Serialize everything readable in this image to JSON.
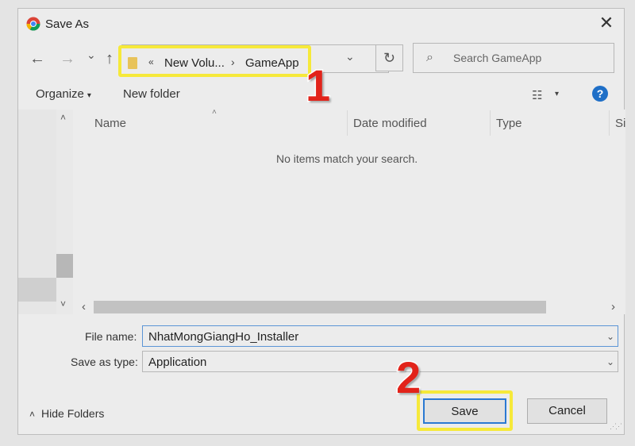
{
  "window": {
    "title": "Save As",
    "close_glyph": "✕"
  },
  "nav": {
    "back": "←",
    "forward": "→",
    "recent": "⌄",
    "up": "↑",
    "breadcrumb": {
      "overflow": "«",
      "part1": "New Volu...",
      "separator": "›",
      "part2": "GameApp"
    },
    "address_dropdown": "⌄",
    "refresh": "↻",
    "search_placeholder": "Search GameApp"
  },
  "toolbar": {
    "organize": "Organize",
    "organize_caret": "▾",
    "new_folder": "New folder",
    "view_icon": "☷",
    "view_caret": "▾",
    "help": "?"
  },
  "list": {
    "columns": {
      "name": "Name",
      "date_modified": "Date modified",
      "type": "Type",
      "size": "Si"
    },
    "sort_indicator": "˄",
    "empty_message": "No items match your search."
  },
  "scroll": {
    "up": "˄",
    "down": "˅",
    "left": "‹",
    "right": "›"
  },
  "form": {
    "file_name_label": "File name:",
    "file_name_value": "NhatMongGiangHo_Installer",
    "save_type_label": "Save as type:",
    "save_type_value": "Application",
    "dropdown_glyph": "⌄"
  },
  "footer": {
    "hide_folders_caret": "˄",
    "hide_folders": "Hide Folders",
    "save": "Save",
    "cancel": "Cancel",
    "grip": "⋰⋰"
  },
  "annotations": {
    "step1": "1",
    "step2": "2",
    "highlight_color": "#f6e93a",
    "number_color": "#e2231a"
  },
  "colors": {
    "accent": "#2b79d2",
    "help_icon": "#1f6fc7"
  }
}
